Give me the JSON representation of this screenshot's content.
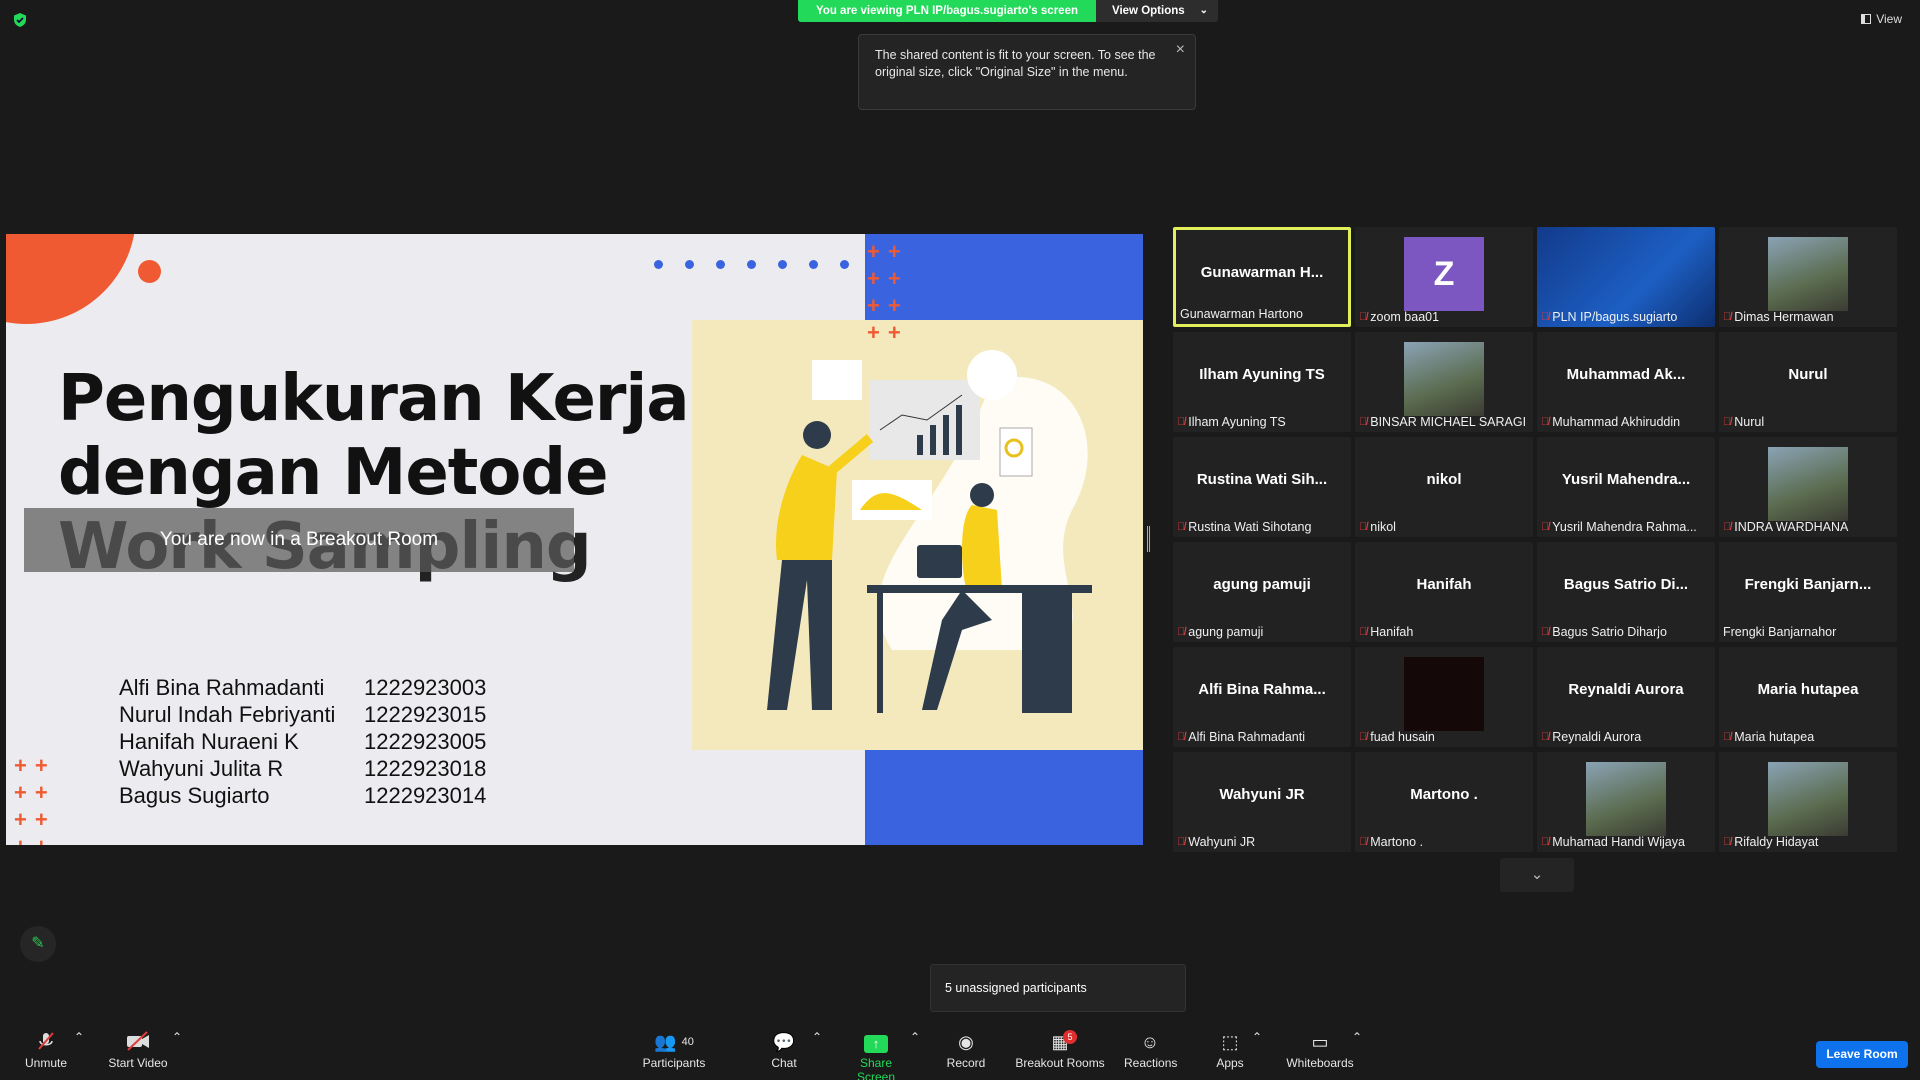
{
  "banner": {
    "text": "You are viewing PLN IP/bagus.sugiarto's screen",
    "view_options": "View Options"
  },
  "tooltip": {
    "text": "The shared content is fit to your screen. To see the original size, click \"Original Size\" in the menu."
  },
  "view_button": "View",
  "slide": {
    "title_lines": [
      "Pengukuran Kerja",
      "dengan Metode",
      "Work Sampling"
    ],
    "breakout_overlay": "You are now in a Breakout Room",
    "members": [
      {
        "name": "Alfi Bina Rahmadanti",
        "id": "1222923003"
      },
      {
        "name": "Nurul Indah Febriyanti",
        "id": "1222923015"
      },
      {
        "name": "Hanifah Nuraeni K",
        "id": "1222923005"
      },
      {
        "name": "Wahyuni Julita R",
        "id": "1222923018"
      },
      {
        "name": "Bagus Sugiarto",
        "id": "1222923014"
      }
    ]
  },
  "tiles": [
    {
      "big": "Gunawarman  H...",
      "label": "Gunawarman Hartono",
      "muted": false,
      "active": true,
      "kind": "text"
    },
    {
      "big": "Z",
      "label": "zoom baa01",
      "muted": true,
      "kind": "avatar"
    },
    {
      "big": "",
      "label": "PLN IP/bagus.sugiarto",
      "muted": true,
      "kind": "screen"
    },
    {
      "big": "",
      "label": "Dimas Hermawan",
      "muted": true,
      "kind": "photo"
    },
    {
      "big": "Ilham Ayuning TS",
      "label": "Ilham Ayuning TS",
      "muted": true,
      "kind": "text"
    },
    {
      "big": "",
      "label": "BINSAR MICHAEL SARAGI",
      "muted": true,
      "kind": "photo"
    },
    {
      "big": "Muhammad  Ak...",
      "label": "Muhammad Akhiruddin",
      "muted": true,
      "kind": "text"
    },
    {
      "big": "Nurul",
      "label": "Nurul",
      "muted": true,
      "kind": "text"
    },
    {
      "big": "Rustina  Wati  Sih...",
      "label": "Rustina Wati Sihotang",
      "muted": true,
      "kind": "text"
    },
    {
      "big": "nikol",
      "label": "nikol",
      "muted": true,
      "kind": "text"
    },
    {
      "big": "Yusril  Mahendra...",
      "label": "Yusril Mahendra Rahma...",
      "muted": true,
      "kind": "text"
    },
    {
      "big": "",
      "label": "INDRA WARDHANA",
      "muted": true,
      "kind": "photo"
    },
    {
      "big": "agung  pamuji",
      "label": "agung pamuji",
      "muted": true,
      "kind": "text"
    },
    {
      "big": "Hanifah",
      "label": "Hanifah",
      "muted": true,
      "kind": "text"
    },
    {
      "big": "Bagus  Satrio  Di...",
      "label": "Bagus Satrio Diharjo",
      "muted": true,
      "kind": "text"
    },
    {
      "big": "Frengki  Banjarn...",
      "label": "Frengki Banjarnahor",
      "muted": false,
      "kind": "text"
    },
    {
      "big": "Alfi  Bina  Rahma...",
      "label": "Alfi Bina Rahmadanti",
      "muted": true,
      "kind": "text"
    },
    {
      "big": "",
      "label": "fuad husain",
      "muted": true,
      "kind": "dark"
    },
    {
      "big": "Reynaldi  Aurora",
      "label": "Reynaldi Aurora",
      "muted": true,
      "kind": "text"
    },
    {
      "big": "Maria  hutapea",
      "label": "Maria hutapea",
      "muted": true,
      "kind": "text"
    },
    {
      "big": "Wahyuni  JR",
      "label": "Wahyuni JR",
      "muted": true,
      "kind": "text"
    },
    {
      "big": "Martono  .",
      "label": "Martono .",
      "muted": true,
      "kind": "text"
    },
    {
      "big": "",
      "label": "Muhamad Handi Wijaya",
      "muted": true,
      "kind": "photo"
    },
    {
      "big": "",
      "label": "Rifaldy Hidayat",
      "muted": true,
      "kind": "photo"
    }
  ],
  "unassigned": "5 unassigned participants",
  "toolbar": {
    "unmute": "Unmute",
    "start_video": "Start Video",
    "participants": "Participants",
    "participants_count": "40",
    "chat": "Chat",
    "share_screen": "Share Screen",
    "record": "Record",
    "breakout_rooms": "Breakout Rooms",
    "breakout_badge": "5",
    "reactions": "Reactions",
    "apps": "Apps",
    "whiteboards": "Whiteboards",
    "leave": "Leave Room"
  },
  "colors": {
    "accent_green": "#23d959",
    "leave_blue": "#0e72ed",
    "active_speaker": "#e1f05a",
    "slide_orange": "#f05a32",
    "slide_blue": "#3a63e0"
  }
}
